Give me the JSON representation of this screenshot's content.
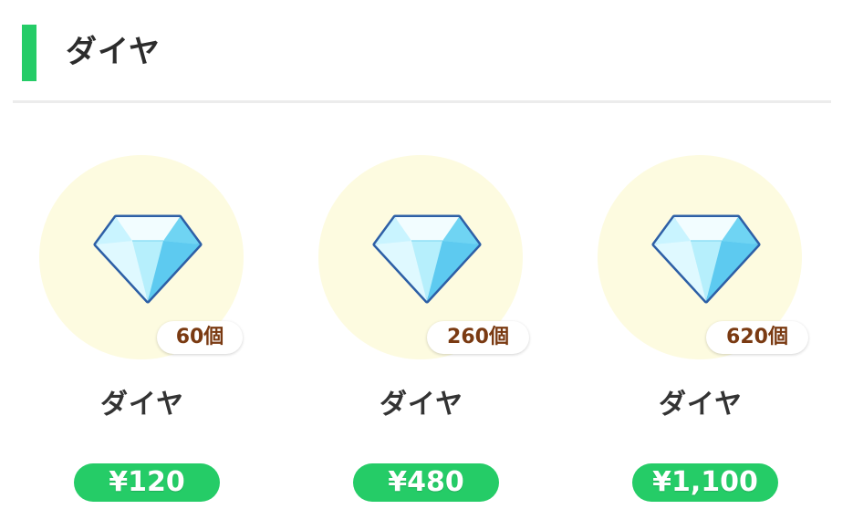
{
  "section": {
    "title": "ダイヤ"
  },
  "colors": {
    "accent": "#25cc67",
    "circle": "#fdfbe0",
    "gem_outline": "#2d5fa6",
    "badge_text": "#7a3a12"
  },
  "products": [
    {
      "name": "ダイヤ",
      "count": "60個",
      "price": "¥120",
      "icon": "diamond-icon"
    },
    {
      "name": "ダイヤ",
      "count": "260個",
      "price": "¥480",
      "icon": "diamond-icon"
    },
    {
      "name": "ダイヤ",
      "count": "620個",
      "price": "¥1,100",
      "icon": "diamond-icon"
    }
  ]
}
